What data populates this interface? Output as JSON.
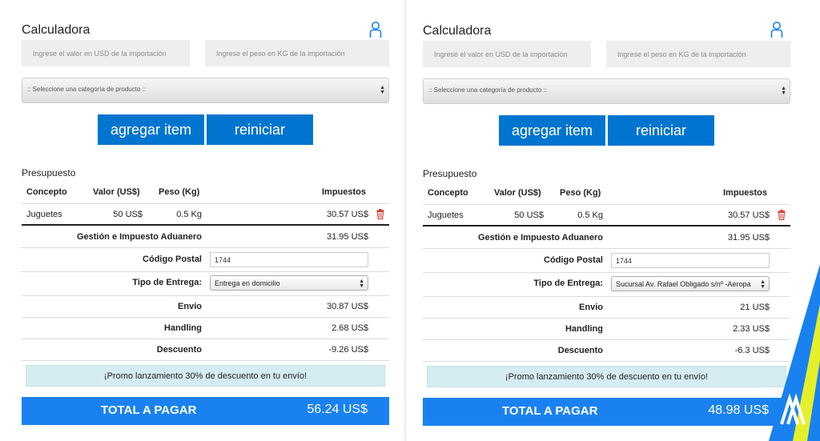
{
  "panels": [
    {
      "title": "Calculadora",
      "inputs": {
        "value_placeholder": "Ingrese el valor en USD de la importación",
        "weight_placeholder": "Ingrese el peso en KG de la importación"
      },
      "category_select": ":: Seleccione una categoría de producto ::",
      "buttons": {
        "add": "agregar item",
        "reset": "reiniciar"
      },
      "budget": {
        "title": "Presupuesto",
        "headers": {
          "concept": "Concepto",
          "value": "Valor (US$)",
          "weight": "Peso (Kg)",
          "taxes": "Impuestos"
        },
        "item": {
          "concept": "Juguetes",
          "value": "50 US$",
          "weight": "0.5 Kg",
          "taxes": "30.57 US$"
        }
      },
      "summary": {
        "customs_label": "Gestión e Impuesto Aduanero",
        "customs_value": "31.95 US$",
        "zip_label": "Código Postal",
        "zip_value": "1744",
        "delivery_label": "Tipo de Entrega:",
        "delivery_value": "Entrega en domicilio",
        "shipping_label": "Envio",
        "shipping_value": "30.87 US$",
        "handling_label": "Handling",
        "handling_value": "2.68 US$",
        "discount_label": "Descuento",
        "discount_value": "-9.26 US$"
      },
      "promo": "¡Promo lanzamiento 30% de descuento en tu envío!",
      "total": {
        "label": "TOTAL A PAGAR",
        "amount": "56.24 US$"
      }
    },
    {
      "title": "Calculadora",
      "inputs": {
        "value_placeholder": "Ingrese el valor en USD de la importación",
        "weight_placeholder": "Ingrese el peso en KG de la importación"
      },
      "category_select": ":: Seleccione una categoría de producto ::",
      "buttons": {
        "add": "agregar item",
        "reset": "reiniciar"
      },
      "budget": {
        "title": "Presupuesto",
        "headers": {
          "concept": "Concepto",
          "value": "Valor (US$)",
          "weight": "Peso (Kg)",
          "taxes": "Impuestos"
        },
        "item": {
          "concept": "Juguetes",
          "value": "50 US$",
          "weight": "0.5 Kg",
          "taxes": "30.57 US$"
        }
      },
      "summary": {
        "customs_label": "Gestión e Impuesto Aduanero",
        "customs_value": "31.95 US$",
        "zip_label": "Código Postal",
        "zip_value": "1744",
        "delivery_label": "Tipo de Entrega:",
        "delivery_value": "Sucursal Av. Rafael Obligado s/nº -Aeropa",
        "shipping_label": "Envio",
        "shipping_value": "21 US$",
        "handling_label": "Handling",
        "handling_value": "2.33 US$",
        "discount_label": "Descuento",
        "discount_value": "-6.3 US$"
      },
      "promo": "¡Promo lanzamiento 30% de descuento en tu envío!",
      "total": {
        "label": "TOTAL A PAGAR",
        "amount": "48.98 US$"
      }
    }
  ],
  "colors": {
    "primary_button": "#0075cf",
    "total_bar": "#1a82f0",
    "promo_bg": "#d4ecf2",
    "trash_icon": "#d9342b",
    "user_icon": "#1a82f0",
    "brand_blue": "#1a82f0",
    "brand_yellow": "#e6f02a"
  },
  "icons": {
    "user": "user-icon",
    "trash": "trash-icon",
    "select_arrows": "select-arrows-icon",
    "brand_logo": "brand-logo-icon"
  }
}
